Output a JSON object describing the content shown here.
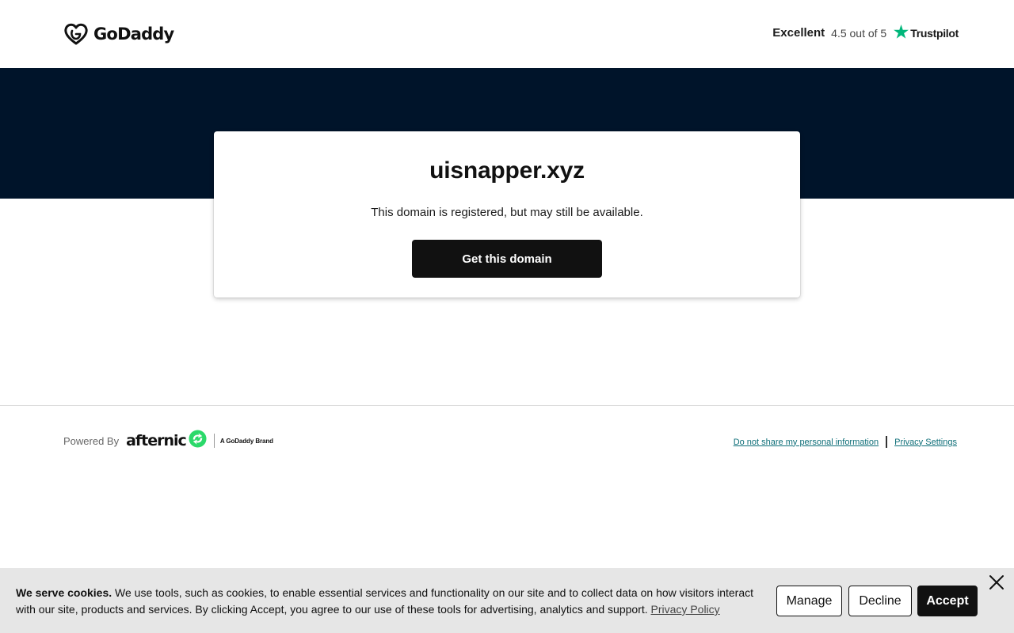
{
  "header": {
    "logo": {
      "text": "GoDaddy",
      "icon": "godaddy-heart-icon"
    },
    "trustpilot": {
      "rating_word": "Excellent",
      "score_text": "4.5 out of 5",
      "brand": "Trustpilot",
      "icon": "trustpilot-star-icon",
      "star_color": "#00b67a"
    }
  },
  "hero": {
    "background_color": "#00142a",
    "domain": "uisnapper.xyz",
    "message": "This domain is registered, but may still be available.",
    "cta_label": "Get this domain"
  },
  "footer": {
    "powered_label": "Powered By",
    "brand": "afternic",
    "brand_icon": "afternic-arrows-icon",
    "brand_color": "#2bd96a",
    "brand_tagline": "A GoDaddy Brand",
    "links": [
      {
        "label": "Do not share my personal information"
      },
      {
        "label": "Privacy Settings"
      }
    ],
    "link_color": "#0d6e78"
  },
  "cookie_banner": {
    "heading": "We serve cookies.",
    "body": " We use tools, such as cookies, to enable essential services and functionality on our site and to collect data on how visitors interact with our site, products and services. By clicking Accept, you agree to our use of these tools for advertising, analytics and support. ",
    "policy_link": "Privacy Policy",
    "buttons": {
      "manage": "Manage",
      "decline": "Decline",
      "accept": "Accept"
    },
    "close_icon": "close-icon"
  }
}
